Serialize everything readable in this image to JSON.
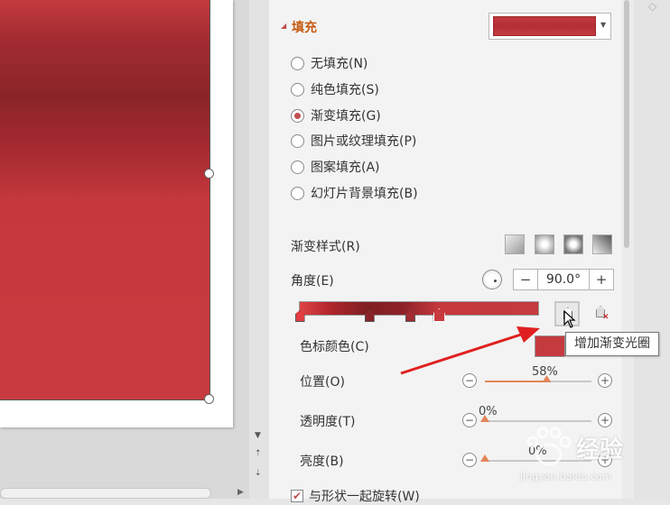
{
  "fill_section": {
    "title": "填充",
    "options": [
      {
        "label": "无填充(N)",
        "checked": false
      },
      {
        "label": "纯色填充(S)",
        "checked": false
      },
      {
        "label": "渐变填充(G)",
        "checked": true
      },
      {
        "label": "图片或纹理填充(P)",
        "checked": false
      },
      {
        "label": "图案填充(A)",
        "checked": false
      },
      {
        "label": "幻灯片背景填充(B)",
        "checked": false
      }
    ]
  },
  "gradient": {
    "style_label": "渐变样式(R)",
    "angle_label": "角度(E)",
    "angle_value": "90.0°",
    "angle_minus": "−",
    "angle_plus": "+",
    "stop_color_label": "色标颜色(C)",
    "add_stop_tooltip": "增加渐变光圈",
    "stop_color": "#c43a3e",
    "stops": [
      {
        "position_pct": 0,
        "color": "#e23d40",
        "selected": false
      },
      {
        "position_pct": 29,
        "color": "#8a2428",
        "selected": false
      },
      {
        "position_pct": 46,
        "color": "#a22c31",
        "selected": false
      },
      {
        "position_pct": 58,
        "color": "#c73b40",
        "selected": true
      }
    ]
  },
  "sliders": {
    "position": {
      "label": "位置(O)",
      "value": "58%",
      "level_pct": 58
    },
    "transparency": {
      "label": "透明度(T)",
      "value": "0%",
      "level_pct": 0
    },
    "brightness": {
      "label": "亮度(B)",
      "value": "0%",
      "level_pct": 0
    }
  },
  "rotate_with_shape": {
    "label": "与形状一起旋转(W)",
    "checked": true
  },
  "watermark": {
    "brand": "经验",
    "url": "jingyan.baidu.com"
  },
  "colors": {
    "accent": "#c55a11",
    "slider": "#e3855a",
    "annotation_arrow": "#e02020"
  }
}
